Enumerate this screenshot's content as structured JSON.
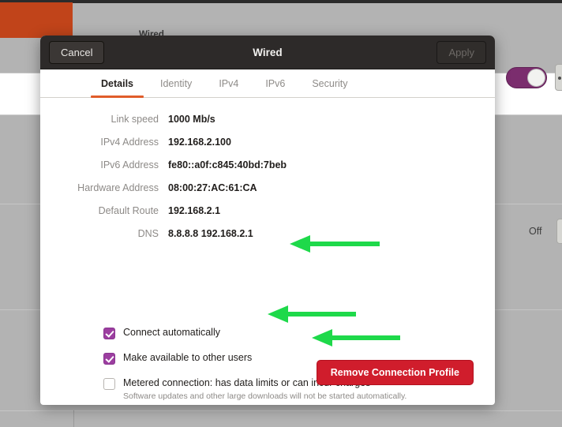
{
  "background": {
    "wired_label": "Wired",
    "off_label": "Off",
    "toggle_state": "on",
    "orange_block_color": "#c1441a",
    "toggle_color": "#7b2d6e",
    "surface_color": "#b3b3b3"
  },
  "dialog": {
    "title": "Wired",
    "cancel_label": "Cancel",
    "apply_label": "Apply",
    "apply_enabled": false,
    "tabs": [
      {
        "label": "Details",
        "active": true
      },
      {
        "label": "Identity",
        "active": false
      },
      {
        "label": "IPv4",
        "active": false
      },
      {
        "label": "IPv6",
        "active": false
      },
      {
        "label": "Security",
        "active": false
      }
    ],
    "accent_color": "#e05c2a",
    "details": [
      {
        "label": "Link speed",
        "value": "1000 Mb/s"
      },
      {
        "label": "IPv4 Address",
        "value": "192.168.2.100"
      },
      {
        "label": "IPv6 Address",
        "value": "fe80::a0f:c845:40bd:7beb"
      },
      {
        "label": "Hardware Address",
        "value": "08:00:27:AC:61:CA"
      },
      {
        "label": "Default Route",
        "value": "192.168.2.1"
      },
      {
        "label": "DNS",
        "value": "8.8.8.8 192.168.2.1"
      }
    ],
    "annotations": {
      "color": "#1ed94a",
      "targets": [
        "IPv4 Address",
        "Default Route",
        "DNS"
      ]
    },
    "checkboxes": [
      {
        "label": "Connect automatically",
        "sublabel": "",
        "checked": true
      },
      {
        "label": "Make available to other users",
        "sublabel": "",
        "checked": true
      },
      {
        "label": "Metered connection: has data limits or can incur charges",
        "sublabel": "Software updates and other large downloads will not be started automatically.",
        "checked": false
      }
    ],
    "checkbox_color": "#9c3ea0",
    "remove_button_label": "Remove Connection Profile",
    "remove_button_color": "#d01d2c"
  }
}
